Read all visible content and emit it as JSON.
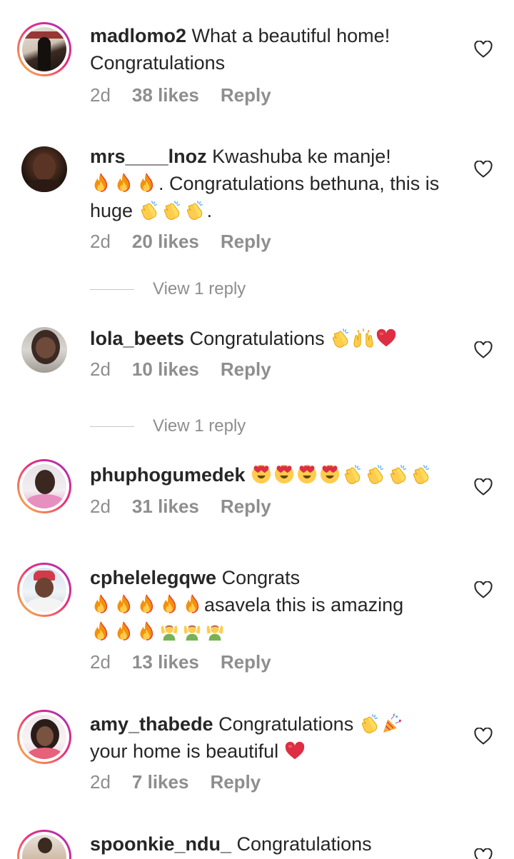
{
  "comments": [
    {
      "username": "madlomo2",
      "text": " What a beautiful home! Congratulations",
      "emojis": [],
      "time": "2d",
      "likes": "38 likes",
      "reply": "Reply",
      "view_replies": ""
    },
    {
      "username": "mrs____lnoz",
      "text": " Kwashuba ke manje!",
      "text2": ". Congratulations bethuna, this is huge",
      "text3": ".",
      "emojis": [
        "fire",
        "fire",
        "fire"
      ],
      "emojis2": [
        "clap",
        "clap",
        "clap"
      ],
      "time": "2d",
      "likes": "20 likes",
      "reply": "Reply",
      "view_replies": "View 1 reply"
    },
    {
      "username": "lola_beets",
      "text": " Congratulations",
      "emojis": [
        "clap",
        "raised-hands",
        "red-heart"
      ],
      "time": "2d",
      "likes": "10 likes",
      "reply": "Reply",
      "view_replies": "View 1 reply"
    },
    {
      "username": "phuphogumedek",
      "text": "",
      "emojis": [
        "heart-eyes",
        "heart-eyes",
        "heart-eyes",
        "heart-eyes",
        "clap",
        "clap",
        "clap",
        "clap"
      ],
      "time": "2d",
      "likes": "31 likes",
      "reply": "Reply"
    },
    {
      "username": "cphelelegqwe",
      "text": " Congrats",
      "text2": "asavela this is amazing",
      "emojis": [
        "fire",
        "fire",
        "fire",
        "fire",
        "fire"
      ],
      "emojis2": [
        "fire",
        "fire",
        "fire",
        "person-raising-hands",
        "person-raising-hands",
        "person-raising-hands"
      ],
      "time": "2d",
      "likes": "13 likes",
      "reply": "Reply"
    },
    {
      "username": "amy_thabede",
      "text": " Congratulations",
      "text2": "your home is beautiful",
      "emojis": [
        "clap",
        "party-popper"
      ],
      "emojis2": [
        "red-heart"
      ],
      "time": "2d",
      "likes": "7 likes",
      "reply": "Reply"
    },
    {
      "username": "spoonkie_ndu_",
      "text": " Congratulations"
    }
  ],
  "colors": {
    "text": "#262626",
    "meta": "#8e8e8e",
    "story_ring_start": "#f9c33c",
    "story_ring_end": "#9c34c2"
  }
}
